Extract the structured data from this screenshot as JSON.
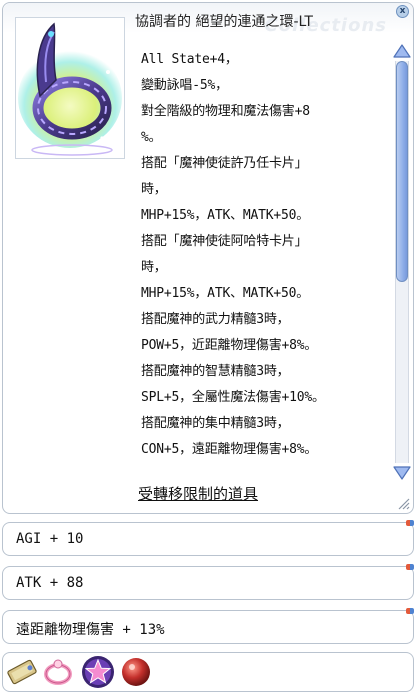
{
  "window": {
    "title": "協調者的 絕望的連通之環-LT",
    "watermark": "Collections",
    "close_label": "x"
  },
  "description": {
    "lines": [
      "All State+4，",
      "變動詠唱-5%，",
      "對全階級的物理和魔法傷害+8",
      "%。",
      "搭配「魔神使徒許乃任卡片」",
      "時，",
      "MHP+15%，ATK、MATK+50。",
      "搭配「魔神使徒阿哈特卡片」",
      "時，",
      "MHP+15%，ATK、MATK+50。",
      "搭配魔神的武力精髓3時，",
      "POW+5，近距離物理傷害+8%。",
      "搭配魔神的智慧精髓3時，",
      "SPL+5，全屬性魔法傷害+10%。",
      "搭配魔神的集中精髓3時，",
      "CON+5，遠距離物理傷害+8%。"
    ],
    "restriction_label": "受轉移限制的道具"
  },
  "scroll": {
    "position_fraction": 0.0,
    "visible_fraction": 0.55
  },
  "options": [
    {
      "text": "AGI + 10"
    },
    {
      "text": "ATK + 88"
    },
    {
      "text": "遠距離物理傷害 + 13%"
    }
  ],
  "slots": [
    {
      "icon": "scroll-card-icon"
    },
    {
      "icon": "pink-ring-enchant-icon"
    },
    {
      "icon": "purple-star-enchant-icon"
    },
    {
      "icon": "red-orb-enchant-icon"
    }
  ],
  "colors": {
    "scroll_thumb": "#8eaee8",
    "border": "#b9c3cf",
    "ring_purple": "#5b4aa0",
    "thumb_glow": "#d9f27a"
  }
}
